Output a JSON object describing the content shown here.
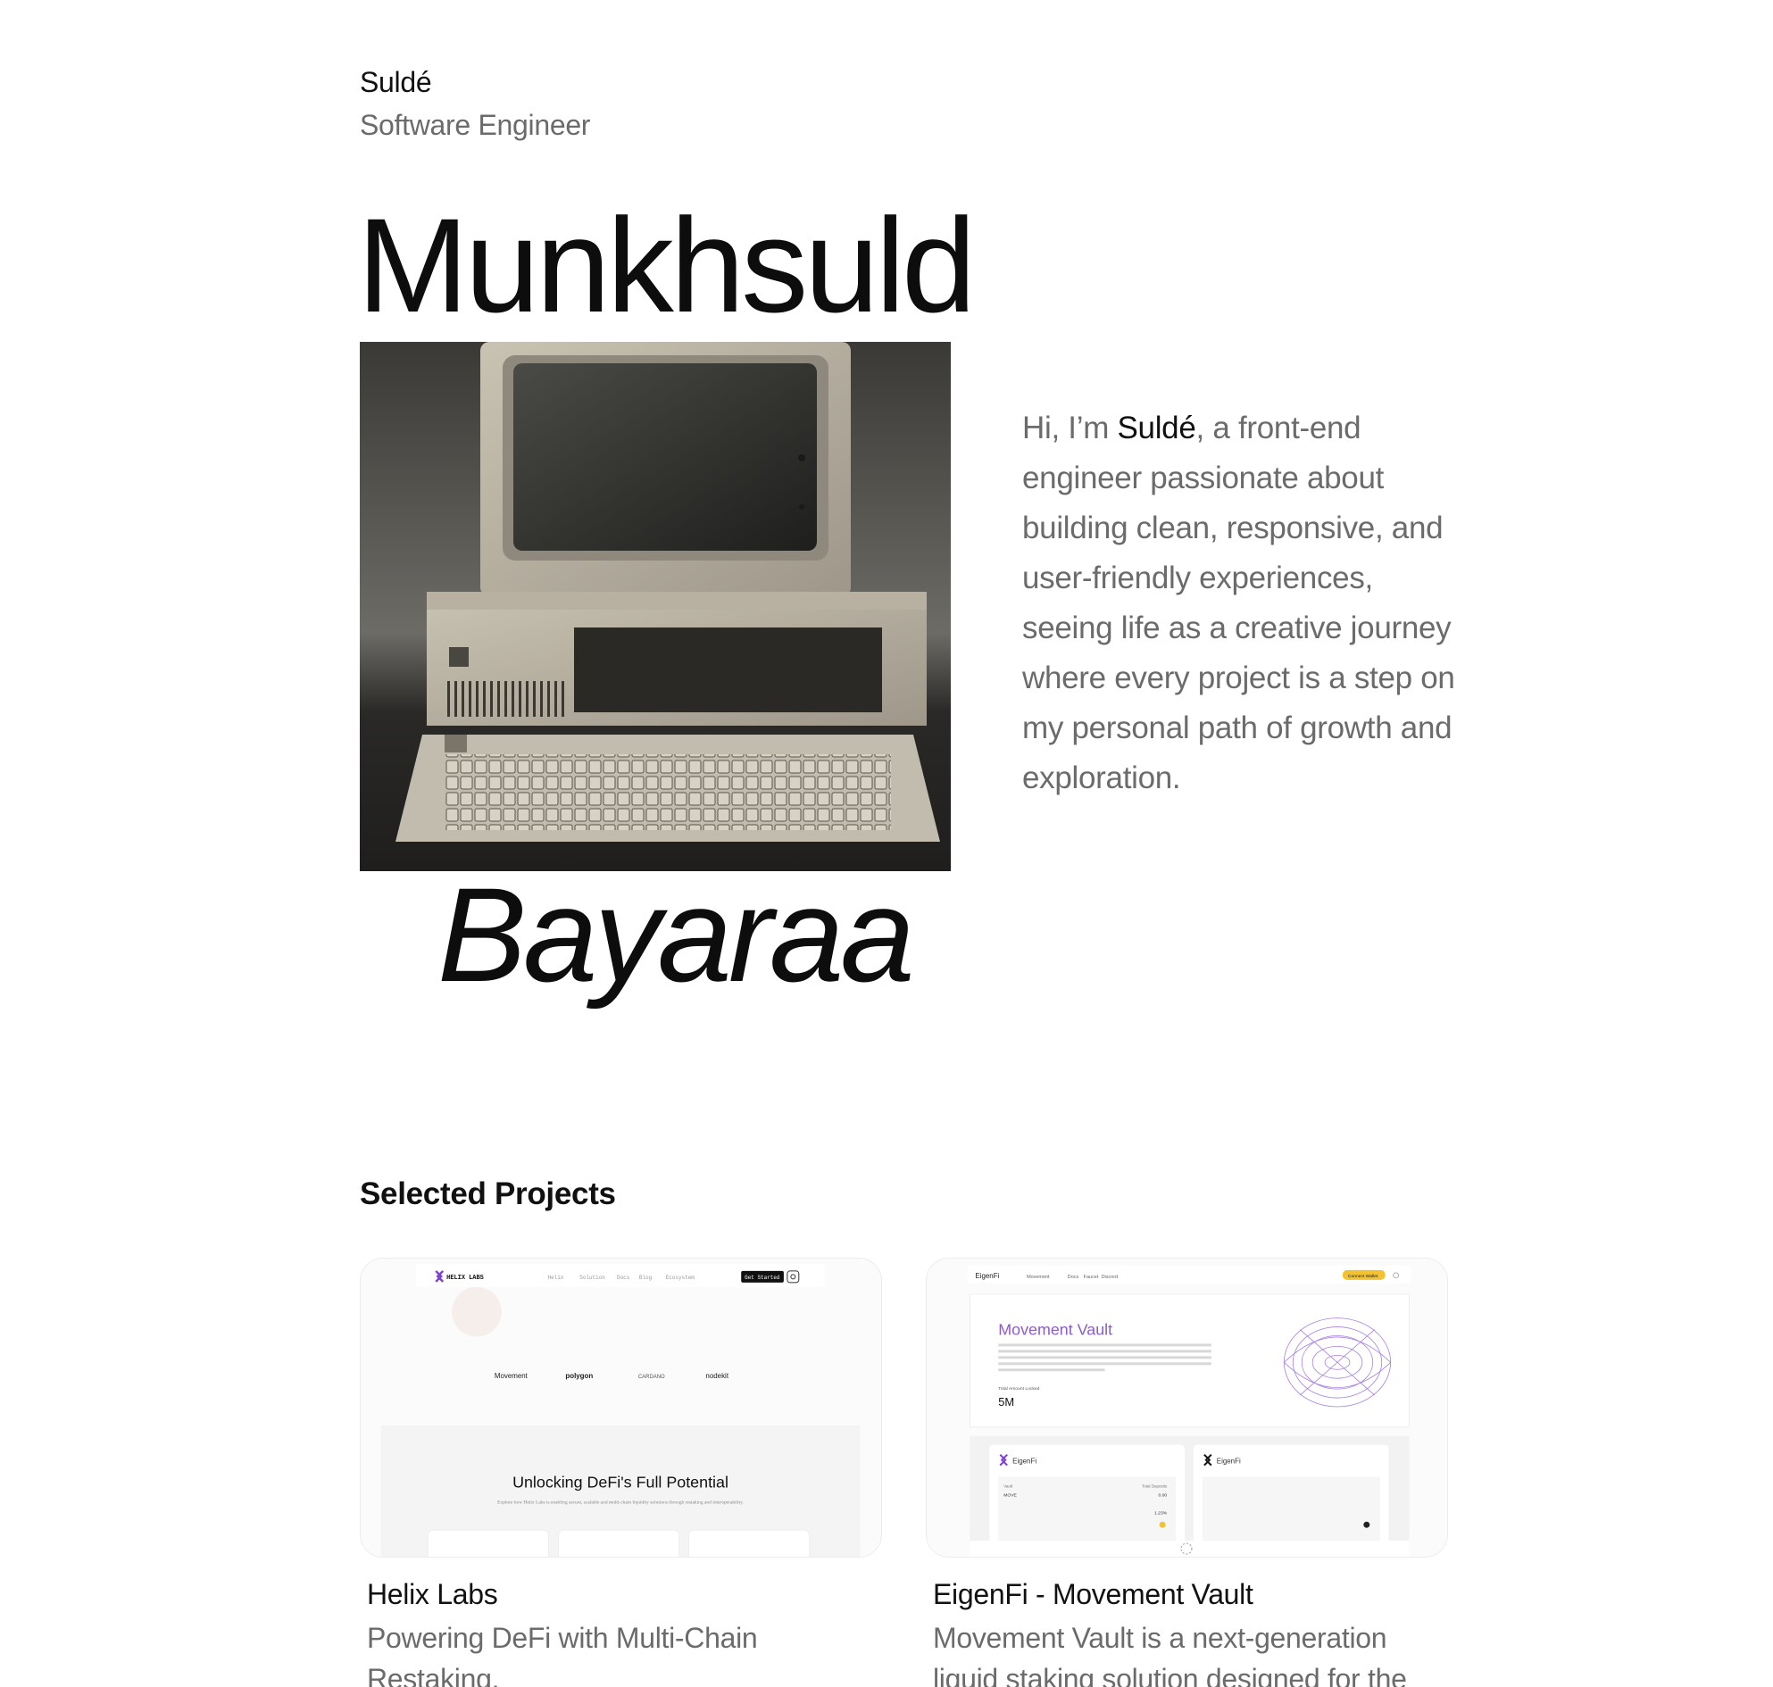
{
  "header": {
    "name": "Suldé",
    "role": "Software Engineer"
  },
  "hero": {
    "first_name": "Munkhsuld",
    "last_name": "Bayaraa",
    "photo_subject": "vintage personal computer with monitor and keyboard"
  },
  "bio": {
    "prefix": "Hi, I’m ",
    "name": "Suldé",
    "text": ", a front-end engineer passionate about building clean, responsive, and user-friendly experiences, seeing life as a creative journey where every project is a step on my personal path of growth and exploration."
  },
  "projects_section": {
    "title": "Selected Projects",
    "items": [
      {
        "title": "Helix Labs",
        "description": "Powering DeFi with Multi-Chain Restaking.",
        "preview": {
          "logo": "HELIX LABS",
          "nav": [
            "Helix",
            "Solution",
            "Docs",
            "Blog",
            "Ecosystem"
          ],
          "cta": "Get Started",
          "partners": [
            "Movement",
            "polygon",
            "CARDANO",
            "nodekit"
          ],
          "headline": "Unlocking DeFi's Full Potential",
          "subtext": "Explore how Helix Labs is enabling secure, scalable and multi-chain liquidity solutions through restaking and interoperability."
        }
      },
      {
        "title": "EigenFi - Movement Vault",
        "description": "Movement Vault is a next-generation liquid staking solution designed for the",
        "preview": {
          "logo": "EigenFi",
          "nav": [
            "Movement",
            "Docs",
            "Faucet",
            "Discord"
          ],
          "cta": "Connect Wallet",
          "vault_title": "Movement Vault",
          "total_label": "Total Amount Locked",
          "total_value": "5M",
          "sub_brand": "EigenFi",
          "stats": [
            {
              "label": "Vault",
              "value": "MOVE"
            },
            {
              "label": "Total Deposits",
              "value": "0.00"
            },
            {
              "label": "APY",
              "value": "1.23%"
            }
          ]
        }
      }
    ]
  },
  "colors": {
    "text_primary": "#111111",
    "text_secondary": "#6b6b6b",
    "card_border": "#ececec",
    "eigen_purple": "#8e5bc7",
    "eigen_yellow": "#f2c230"
  }
}
